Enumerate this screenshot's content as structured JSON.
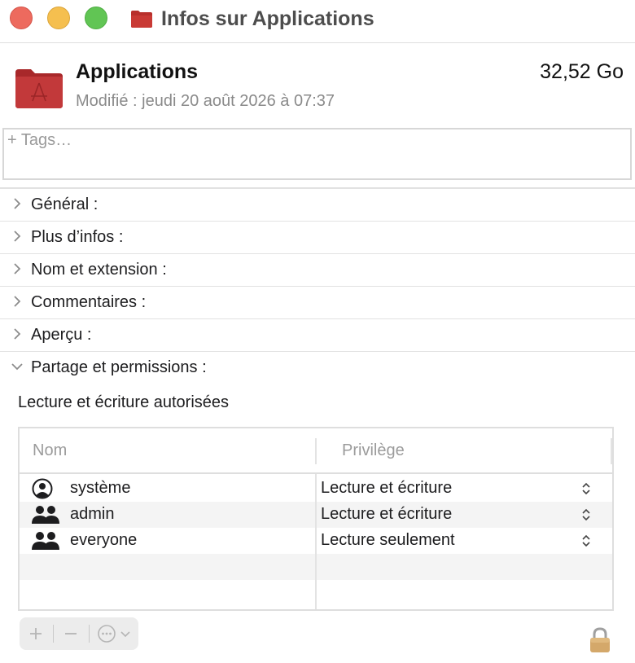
{
  "window": {
    "title": "Infos sur Applications"
  },
  "header": {
    "name": "Applications",
    "size": "32,52 Go",
    "modified": "Modifié : jeudi 20 août 2026 à 07:37"
  },
  "tags": {
    "placeholder": "+ Tags…"
  },
  "sections": [
    {
      "label": "Général :",
      "expanded": false
    },
    {
      "label": "Plus d’infos :",
      "expanded": false
    },
    {
      "label": "Nom et extension :",
      "expanded": false
    },
    {
      "label": "Commentaires :",
      "expanded": false
    },
    {
      "label": "Aperçu :",
      "expanded": false
    },
    {
      "label": "Partage et permissions :",
      "expanded": true
    }
  ],
  "permissions": {
    "description": "Lecture et écriture autorisées",
    "columns": {
      "name": "Nom",
      "privilege": "Privilège"
    },
    "rows": [
      {
        "name": "système",
        "privilege": "Lecture et écriture",
        "icon": "user-icon"
      },
      {
        "name": "admin",
        "privilege": "Lecture et écriture",
        "icon": "group-icon"
      },
      {
        "name": "everyone",
        "privilege": "Lecture seulement",
        "icon": "group-icon"
      }
    ]
  },
  "toolbar": {
    "add": "+",
    "remove": "−",
    "icons": [
      "plus-icon",
      "minus-icon",
      "ellipsis-circle-icon",
      "chevron-down-icon",
      "lock-icon"
    ]
  },
  "colors": {
    "folder": "#b8302c",
    "close": "#ed6a5e",
    "minimize": "#f5bf4f",
    "maximize": "#61c554"
  }
}
